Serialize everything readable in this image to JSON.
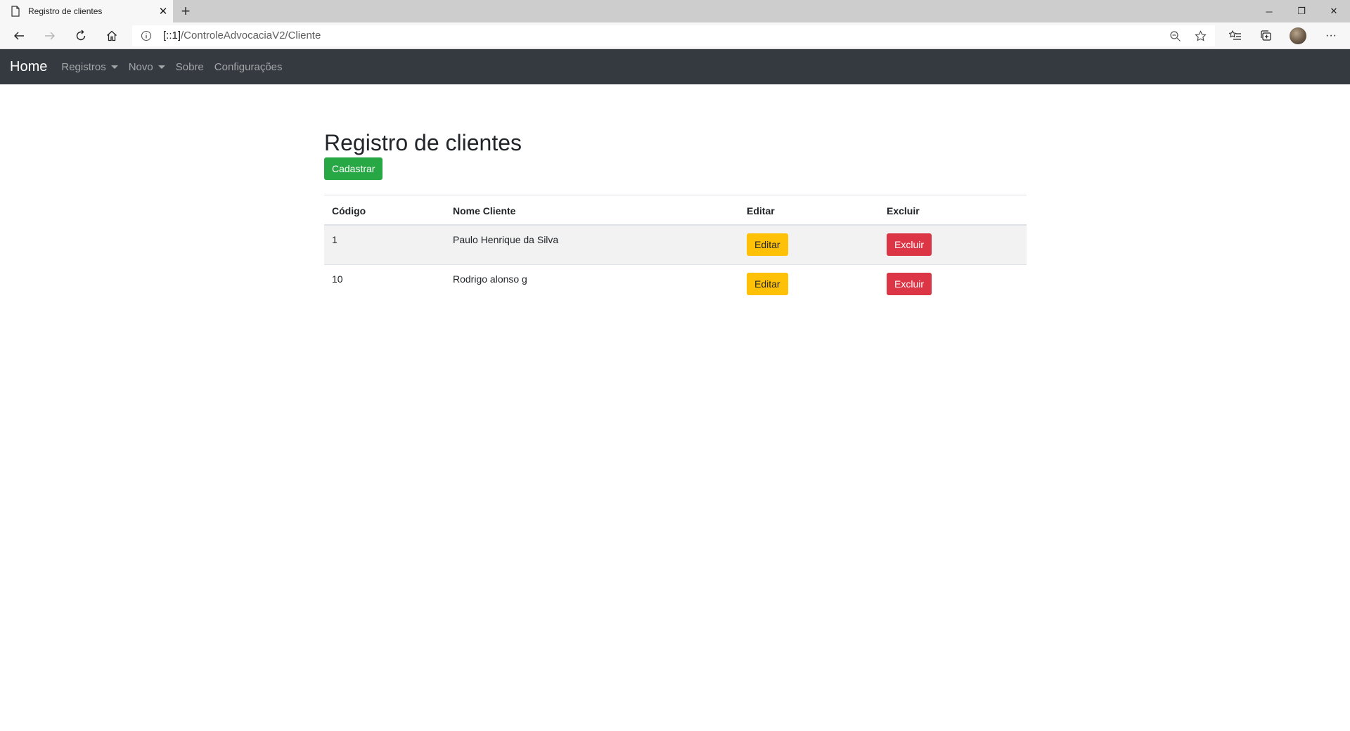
{
  "browser": {
    "tab_title": "Registro de clientes",
    "tab_close": "✕",
    "new_tab": "+",
    "url_host": "[::1]",
    "url_path": "/ControleAdvocaciaV2/Cliente",
    "window_minimize": "─",
    "window_restore": "❐",
    "window_close": "✕",
    "more": "···"
  },
  "navbar": {
    "brand": "Home",
    "items": [
      {
        "label": "Registros",
        "dropdown": true
      },
      {
        "label": "Novo",
        "dropdown": true
      },
      {
        "label": "Sobre",
        "dropdown": false
      },
      {
        "label": "Configurações",
        "dropdown": false
      }
    ]
  },
  "main": {
    "title": "Registro de clientes",
    "add_button": "Cadastrar",
    "table": {
      "headers": [
        "Código",
        "Nome Cliente",
        "Editar",
        "Excluir"
      ],
      "rows": [
        {
          "code": "1",
          "name": "Paulo Henrique da Silva",
          "edit": "Editar",
          "delete": "Excluir"
        },
        {
          "code": "10",
          "name": "Rodrigo alonso g",
          "edit": "Editar",
          "delete": "Excluir"
        }
      ]
    }
  },
  "colors": {
    "navbar": "#343a40",
    "success": "#28a745",
    "warning": "#ffc107",
    "danger": "#dc3545"
  }
}
